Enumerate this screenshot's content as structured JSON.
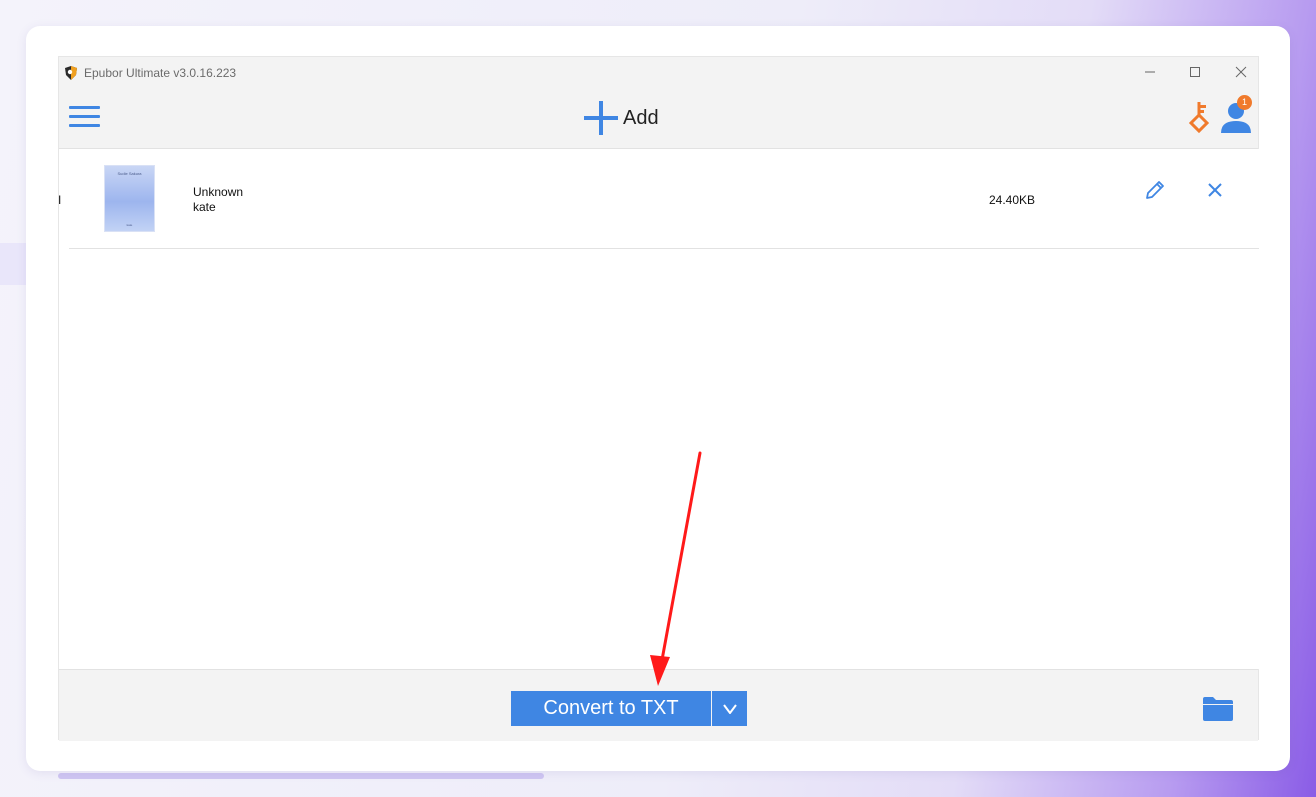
{
  "window": {
    "title": "Epubor Ultimate v3.0.16.223"
  },
  "toolbar": {
    "add_label": "Add",
    "notification_count": "1"
  },
  "books": [
    {
      "cover_title": "Sudie Sakura",
      "cover_author": "kate",
      "title": "Unknown",
      "author": "kate",
      "size": "24.40KB"
    }
  ],
  "bottom": {
    "convert_label": "Convert to TXT"
  },
  "row_cut_char": "I",
  "icons": {
    "app": "epubor-logo-icon",
    "menu": "hamburger-menu-icon",
    "add": "plus-icon",
    "key": "key-icon",
    "user": "user-icon",
    "edit": "pencil-icon",
    "remove": "close-icon",
    "dropdown": "chevron-down-icon",
    "folder": "folder-icon"
  },
  "colors": {
    "accent_blue": "#3f86e3",
    "key_orange": "#f07a2c",
    "annotation_red": "#ff1a1a"
  }
}
